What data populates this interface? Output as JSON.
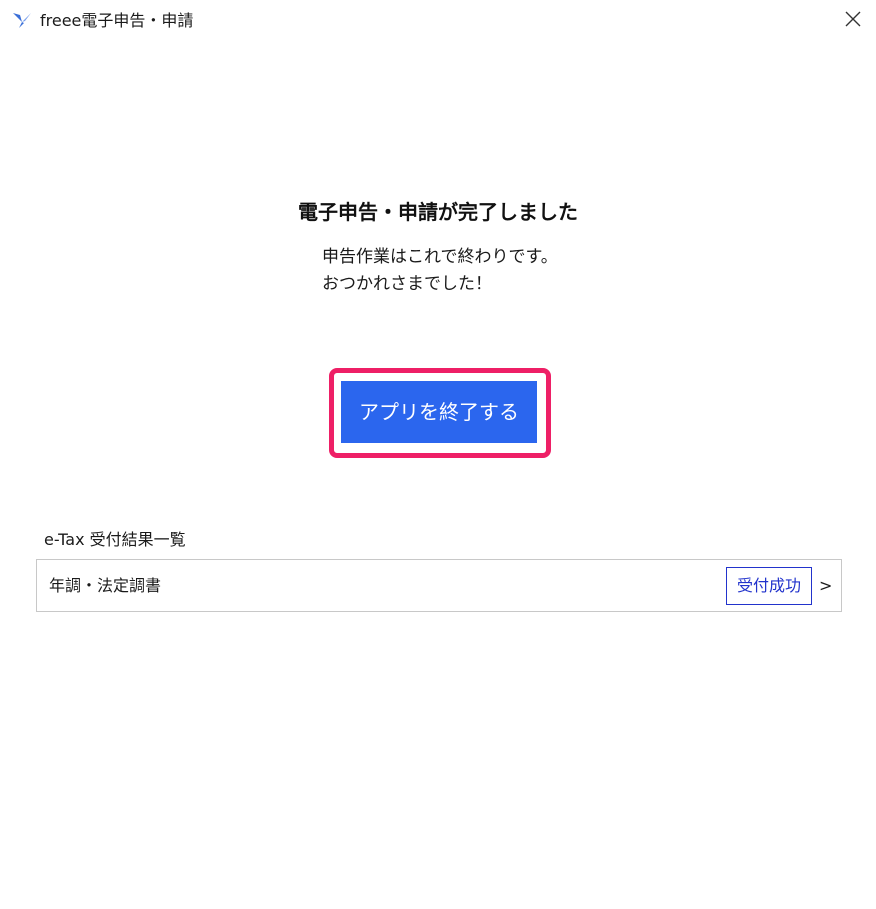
{
  "window": {
    "title": "freee電子申告・申請",
    "icon": "freee-bird-icon",
    "close_icon": "close-icon"
  },
  "main": {
    "headline": "電子申告・申請が完了しました",
    "message_line1": "申告作業はこれで終わりです。",
    "message_line2": "おつかれさまでした！",
    "quit_button_label": "アプリを終了する"
  },
  "results": {
    "label": "e-Tax 受付結果一覧",
    "items": [
      {
        "title": "年調・法定調書",
        "status": "受付成功",
        "chevron": ">"
      }
    ]
  },
  "colors": {
    "primary_button": "#2b66ee",
    "highlight_frame": "#ee1f66",
    "status_badge": "#2233cc",
    "app_icon": "#3a6fd8"
  }
}
